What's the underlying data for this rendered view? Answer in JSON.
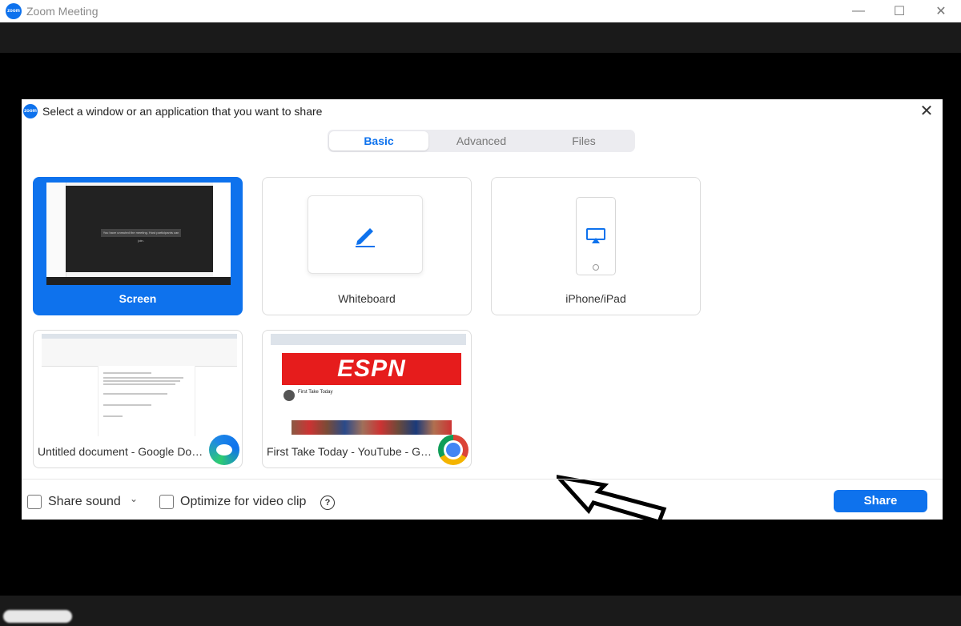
{
  "window": {
    "title": "Zoom Meeting",
    "logo_text": "zoom",
    "minimize_glyph": "—",
    "maximize_glyph": "☐",
    "close_glyph": "✕"
  },
  "dialog": {
    "title": "Select a window or an application that you want to share",
    "close_glyph": "✕",
    "tabs": [
      {
        "label": "Basic",
        "active": true
      },
      {
        "label": "Advanced",
        "active": false
      },
      {
        "label": "Files",
        "active": false
      }
    ],
    "tiles": {
      "screen": {
        "label": "Screen",
        "selected": true,
        "preview_message": "You have unmuted the meeting. Host participants can join."
      },
      "whiteboard": {
        "label": "Whiteboard"
      },
      "iphone": {
        "label": "iPhone/iPad"
      },
      "doc": {
        "label": "Untitled document - Google Doc...",
        "app": "edge-icon"
      },
      "youtube": {
        "label": "First Take Today - YouTube - Goo...",
        "app": "chrome-icon",
        "banner": "ESPN",
        "channel": "First Take Today"
      }
    },
    "footer": {
      "share_sound": "Share sound",
      "optimize": "Optimize for video clip",
      "help_glyph": "?",
      "chevron_glyph": "⌄",
      "share_button": "Share"
    }
  },
  "colors": {
    "accent": "#0e72ed",
    "background": "#000000"
  }
}
